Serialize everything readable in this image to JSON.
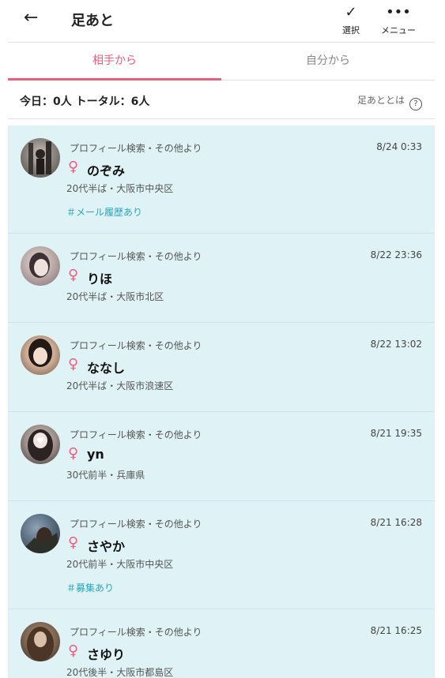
{
  "header": {
    "back_icon": "←",
    "title": "足あと",
    "select_icon": "✓",
    "select_label": "選択",
    "menu_icon": "•••",
    "menu_label": "メニュー"
  },
  "tabs": [
    {
      "label": "相手から",
      "active": true
    },
    {
      "label": "自分から",
      "active": false
    }
  ],
  "summary": {
    "text": "今日：0人 トータル：6人",
    "about_label": "足あととは",
    "help_icon": "?"
  },
  "colors": {
    "accent_pink": "#e8607e",
    "list_bg": "#dff2f6",
    "tag_teal": "#2aa6b8"
  },
  "footprints": [
    {
      "source": "プロフィール検索・その他より",
      "date": "8/24 0:33",
      "gender_icon": "♀",
      "name": "のぞみ",
      "meta": "20代半ば・大阪市中央区",
      "tag": "＃メール履歴あり"
    },
    {
      "source": "プロフィール検索・その他より",
      "date": "8/22 23:36",
      "gender_icon": "♀",
      "name": "りほ",
      "meta": "20代半ば・大阪市北区",
      "tag": ""
    },
    {
      "source": "プロフィール検索・その他より",
      "date": "8/22 13:02",
      "gender_icon": "♀",
      "name": "ななし",
      "meta": "20代半ば・大阪市浪速区",
      "tag": ""
    },
    {
      "source": "プロフィール検索・その他より",
      "date": "8/21 19:35",
      "gender_icon": "♀",
      "name": "yn",
      "meta": "30代前半・兵庫県",
      "tag": ""
    },
    {
      "source": "プロフィール検索・その他より",
      "date": "8/21 16:28",
      "gender_icon": "♀",
      "name": "さやか",
      "meta": "20代前半・大阪市中央区",
      "tag": "＃募集あり"
    },
    {
      "source": "プロフィール検索・その他より",
      "date": "8/21 16:25",
      "gender_icon": "♀",
      "name": "さゆり",
      "meta": "20代後半・大阪市都島区",
      "tag": ""
    }
  ]
}
